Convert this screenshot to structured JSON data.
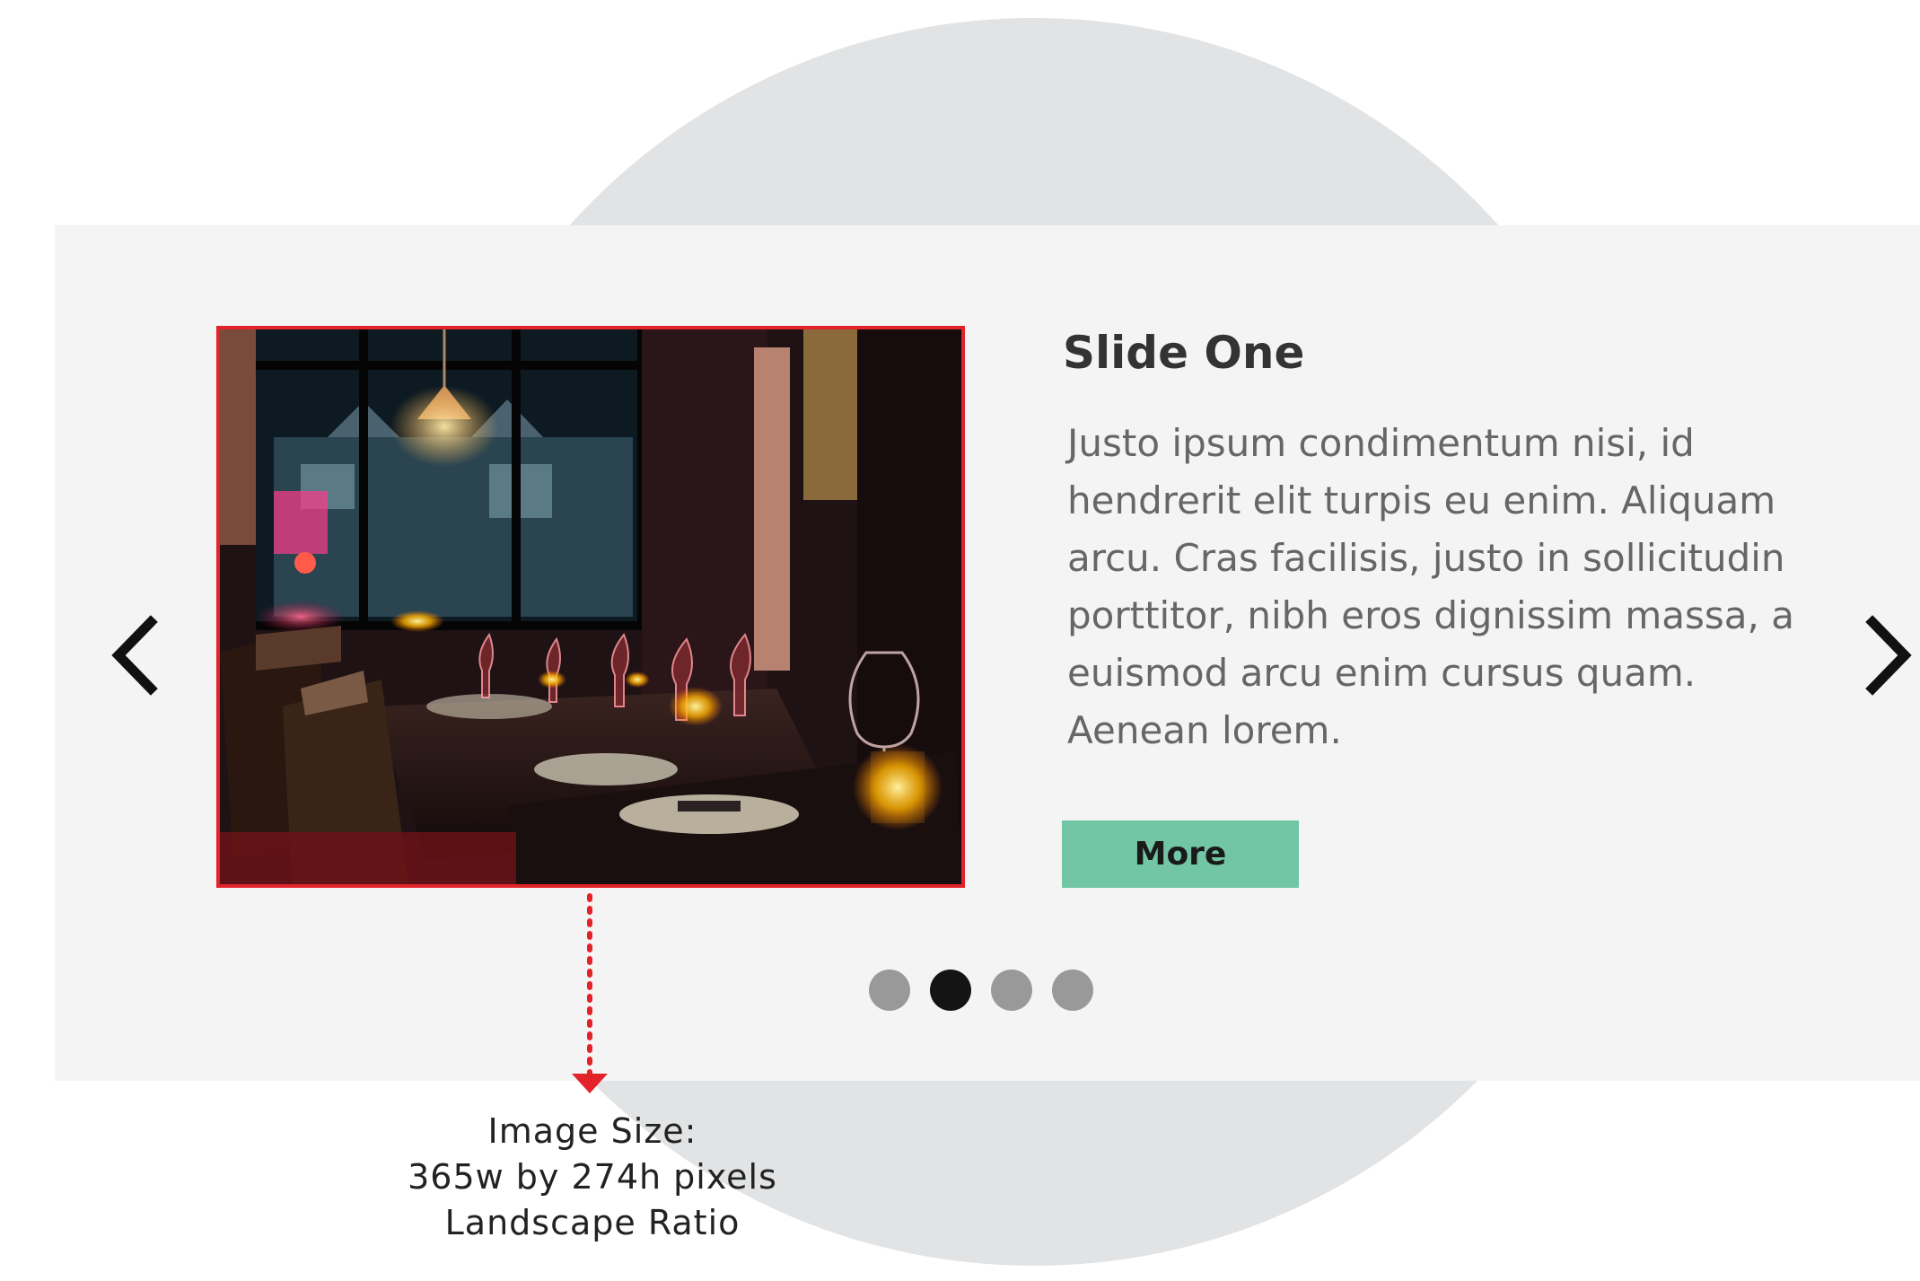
{
  "slide": {
    "title": "Slide One",
    "body": "Justo ipsum condimentum nisi, id hendrerit elit turpis eu enim. Aliquam arcu. Cras facilisis, justo in sollicitudin porttitor, nibh eros dignissim massa, a euismod arcu enim cursus quam. Aenean lorem.",
    "button_label": "More",
    "image_icon": "restaurant-photo"
  },
  "navigation": {
    "prev_icon": "chevron-left-icon",
    "next_icon": "chevron-right-icon"
  },
  "pagination": {
    "total": 4,
    "active_index": 1
  },
  "annotation": {
    "line1": "Image Size:",
    "line2": "365w by 274h pixels",
    "line3": "Landscape Ratio"
  },
  "colors": {
    "image_border": "#e3232a",
    "button_bg": "#72c6a6",
    "panel_bg": "#f4f4f4",
    "circle_bg": "#e2e3e4",
    "dot_active": "#141414",
    "dot_inactive": "#999999"
  }
}
